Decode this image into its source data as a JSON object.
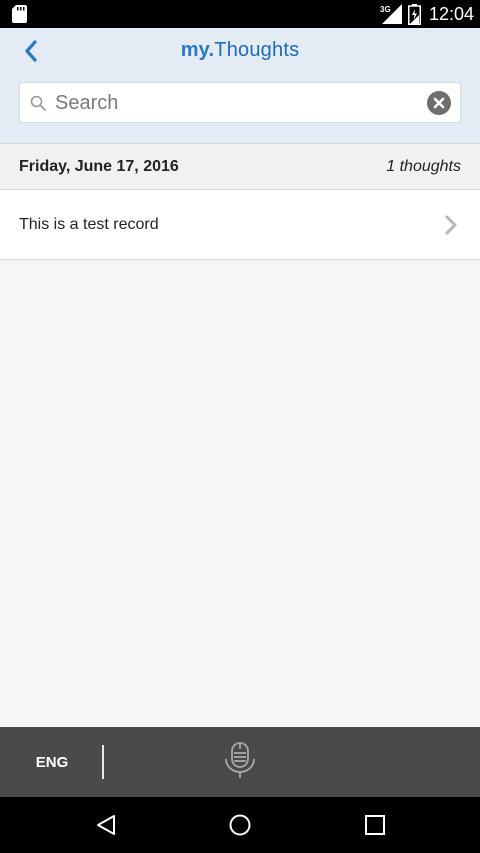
{
  "status_bar": {
    "time": "12:04",
    "network_label": "3G",
    "icons": [
      "sd-card-icon",
      "signal-icon",
      "battery-icon"
    ]
  },
  "header": {
    "title_prefix": "my.",
    "title_main": "Thoughts",
    "back_icon": "chevron-left-icon",
    "accent_color": "#2a78c2",
    "background_color": "#e3ebf4"
  },
  "search": {
    "placeholder": "Search",
    "value": "",
    "search_icon": "search-icon",
    "clear_icon": "clear-circle-icon"
  },
  "sections": [
    {
      "date": "Friday, June 17, 2016",
      "count_label": "1 thoughts",
      "items": [
        {
          "label": "This is a test record",
          "icon": "chevron-right-icon"
        }
      ]
    }
  ],
  "keyboard_voice_bar": {
    "language": "ENG",
    "mic_icon": "microphone-icon"
  },
  "nav_bar": {
    "icons": [
      "nav-back-icon",
      "nav-home-icon",
      "nav-recents-icon"
    ]
  }
}
